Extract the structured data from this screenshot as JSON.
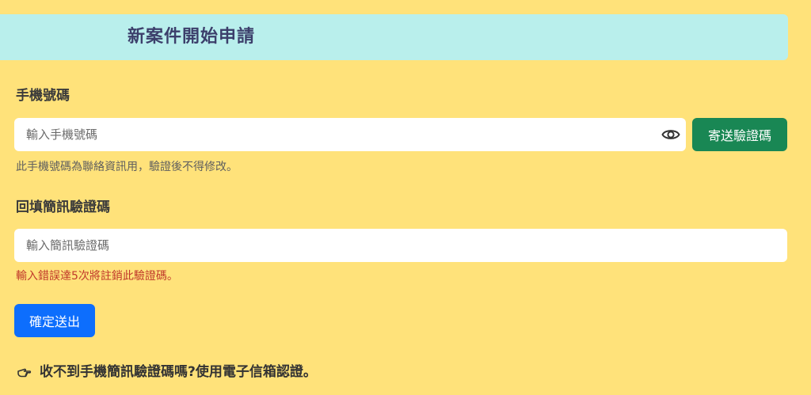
{
  "header": {
    "title": "新案件開始申請"
  },
  "phone_section": {
    "label": "手機號碼",
    "placeholder": "輸入手機號碼",
    "value": "",
    "send_button_label": "寄送驗證碼",
    "help_text": "此手機號碼為聯絡資訊用，驗證後不得修改。"
  },
  "sms_section": {
    "label": "回填簡訊驗證碼",
    "placeholder": "輸入簡訊驗證碼",
    "value": "",
    "warning_text": "輸入錯誤達5次將註銷此驗證碼。"
  },
  "submit": {
    "label": "確定送出"
  },
  "email_alternative": {
    "text": "收不到手機簡訊驗證碼嗎?使用電子信箱認證。"
  },
  "colors": {
    "background": "#ffe27a",
    "header_background": "#b9efec",
    "send_button": "#198754",
    "submit_button": "#0d6efd",
    "warning_text": "#c0392b"
  },
  "icons": {
    "password_toggle": "eye-icon",
    "email_link": "pointing-hand-icon"
  }
}
